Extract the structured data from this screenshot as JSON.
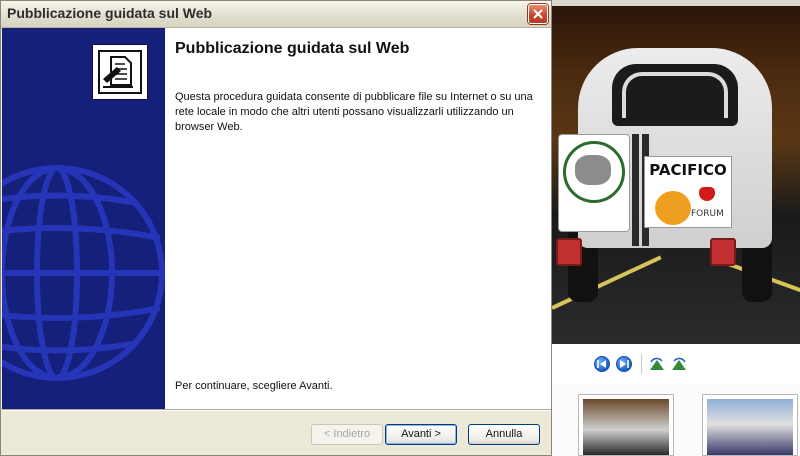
{
  "window": {
    "title": "Pubblicazione guidata sul Web"
  },
  "wizard": {
    "heading": "Pubblicazione guidata sul Web",
    "description": "Questa procedura guidata consente di pubblicare file su Internet o su una rete locale in modo che altri utenti possano visualizzarli utilizzando un browser Web.",
    "continue_hint": "Per continuare, scegliere Avanti.",
    "buttons": {
      "back": "< Indietro",
      "next": "Avanti >",
      "cancel": "Annulla"
    },
    "back_enabled": false
  },
  "viewer": {
    "photo_sticker_title": "PACIFICO",
    "photo_sticker_sub": "FORUM",
    "icons": [
      "previous-icon",
      "next-icon",
      "rotate-left-icon",
      "rotate-right-icon"
    ]
  },
  "colors": {
    "left_panel": "#14207a",
    "accent_blue": "#1b5fc4",
    "close_red": "#c84a2e"
  }
}
